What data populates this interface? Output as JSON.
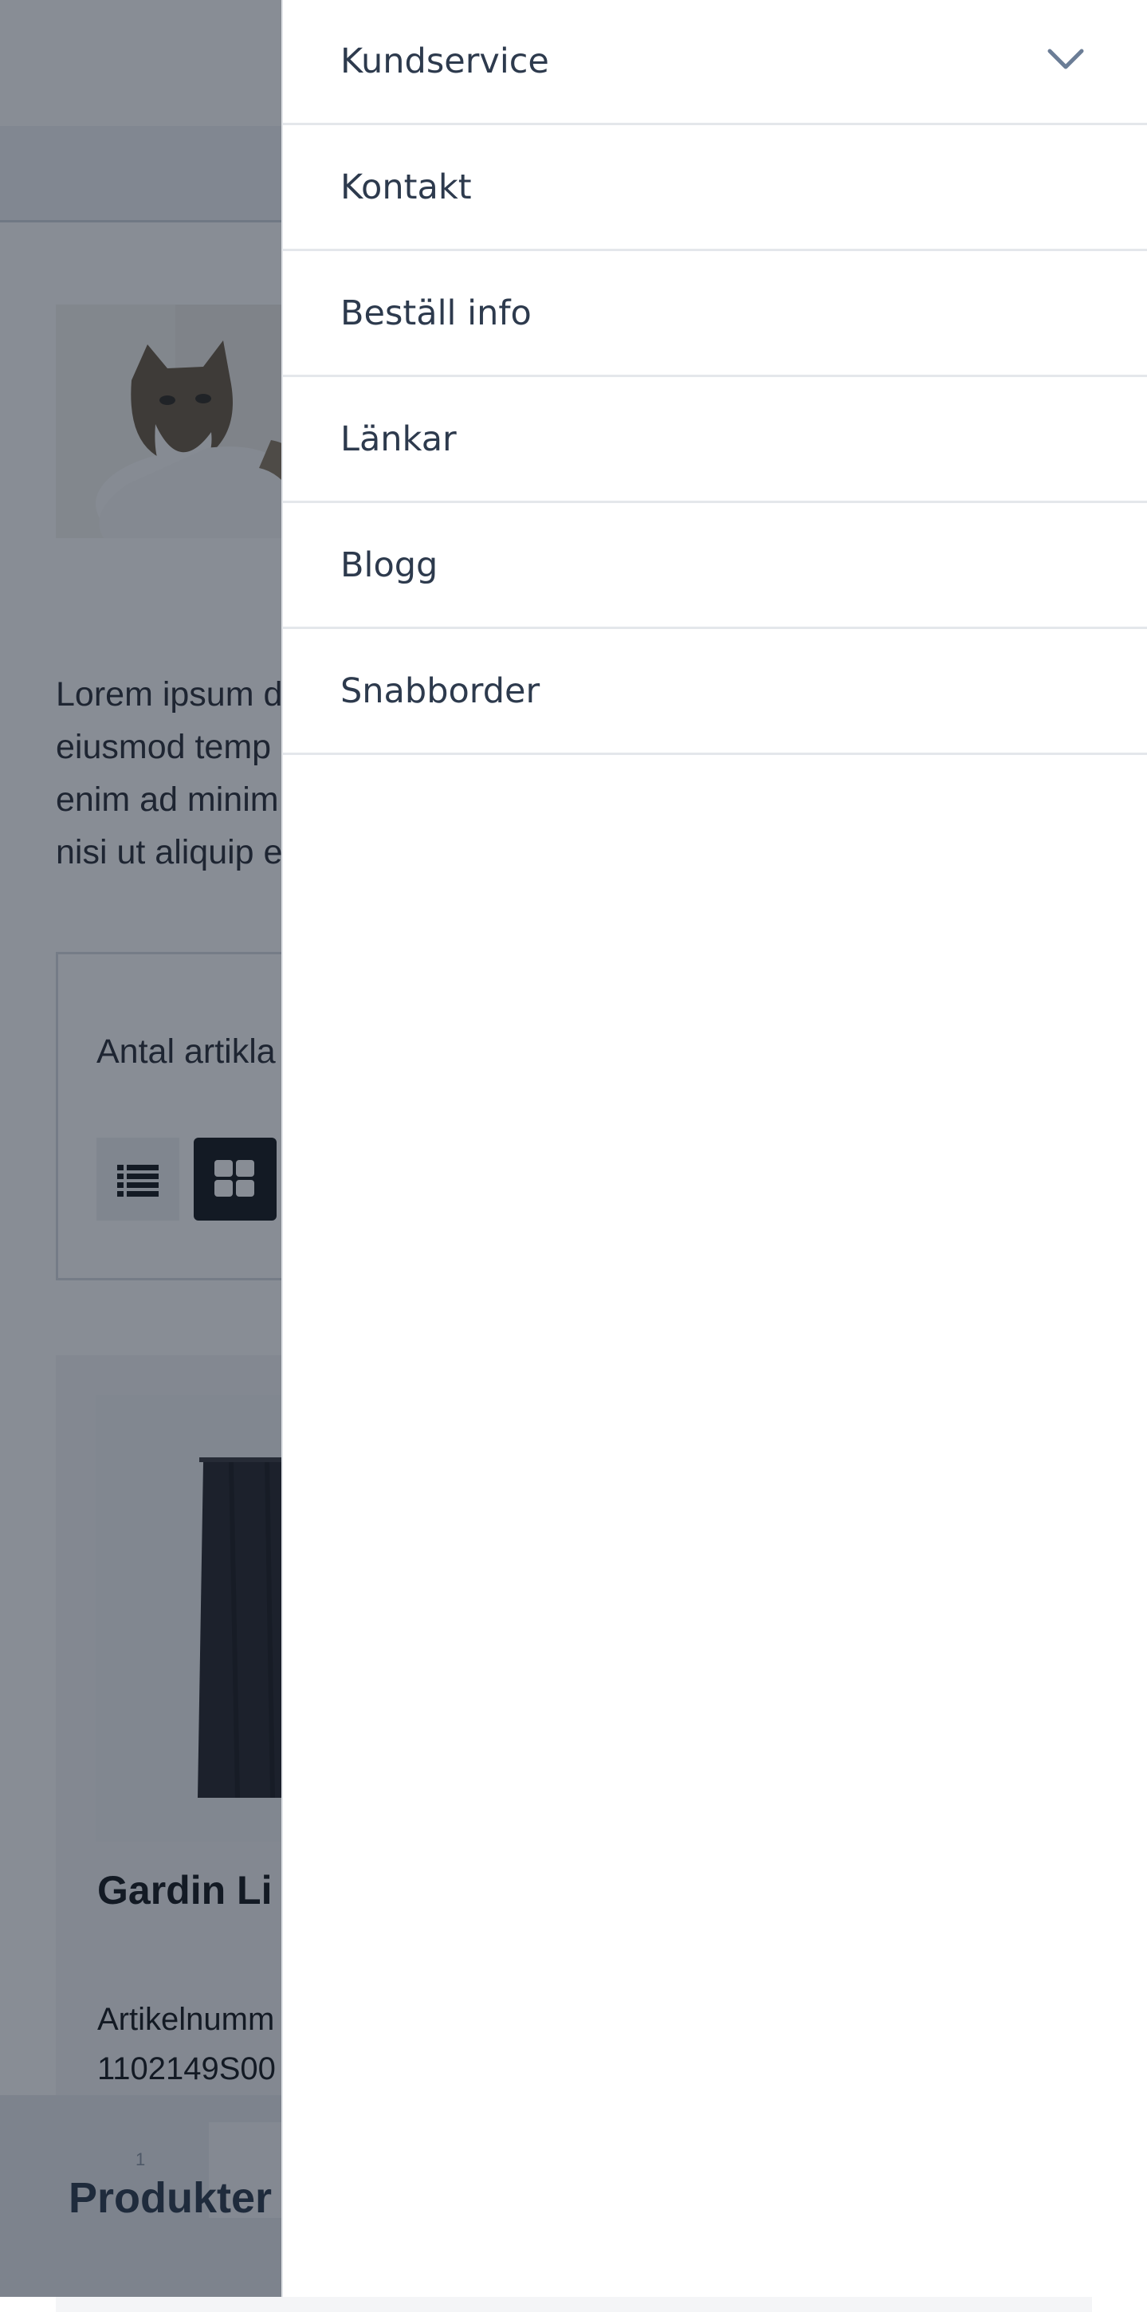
{
  "background_page": {
    "description_lines": [
      "Lorem ipsum d",
      "eiusmod temp",
      "enim ad minim",
      "nisi ut aliquip e"
    ],
    "toolbar": {
      "count_label": "Antal artikla",
      "list_view_icon": "list-icon",
      "grid_view_icon": "grid-icon"
    },
    "product": {
      "name": "Gardin Li",
      "article_label": "Artikelnumm",
      "article_number": "1102149S00"
    },
    "bottom_bar": {
      "label": "Produkter",
      "number": "1"
    }
  },
  "drawer": {
    "items": [
      {
        "label": "Kundservice",
        "icon": "chevron-down-icon"
      },
      {
        "label": "Kontakt"
      },
      {
        "label": "Beställ info"
      },
      {
        "label": "Länkar"
      },
      {
        "label": "Blogg"
      },
      {
        "label": "Snabborder"
      }
    ]
  },
  "colors": {
    "overlay": "#121c2c",
    "drawer_text": "#2d3a4d",
    "chevron": "#6b7d96",
    "divider": "#e4e7eb"
  }
}
